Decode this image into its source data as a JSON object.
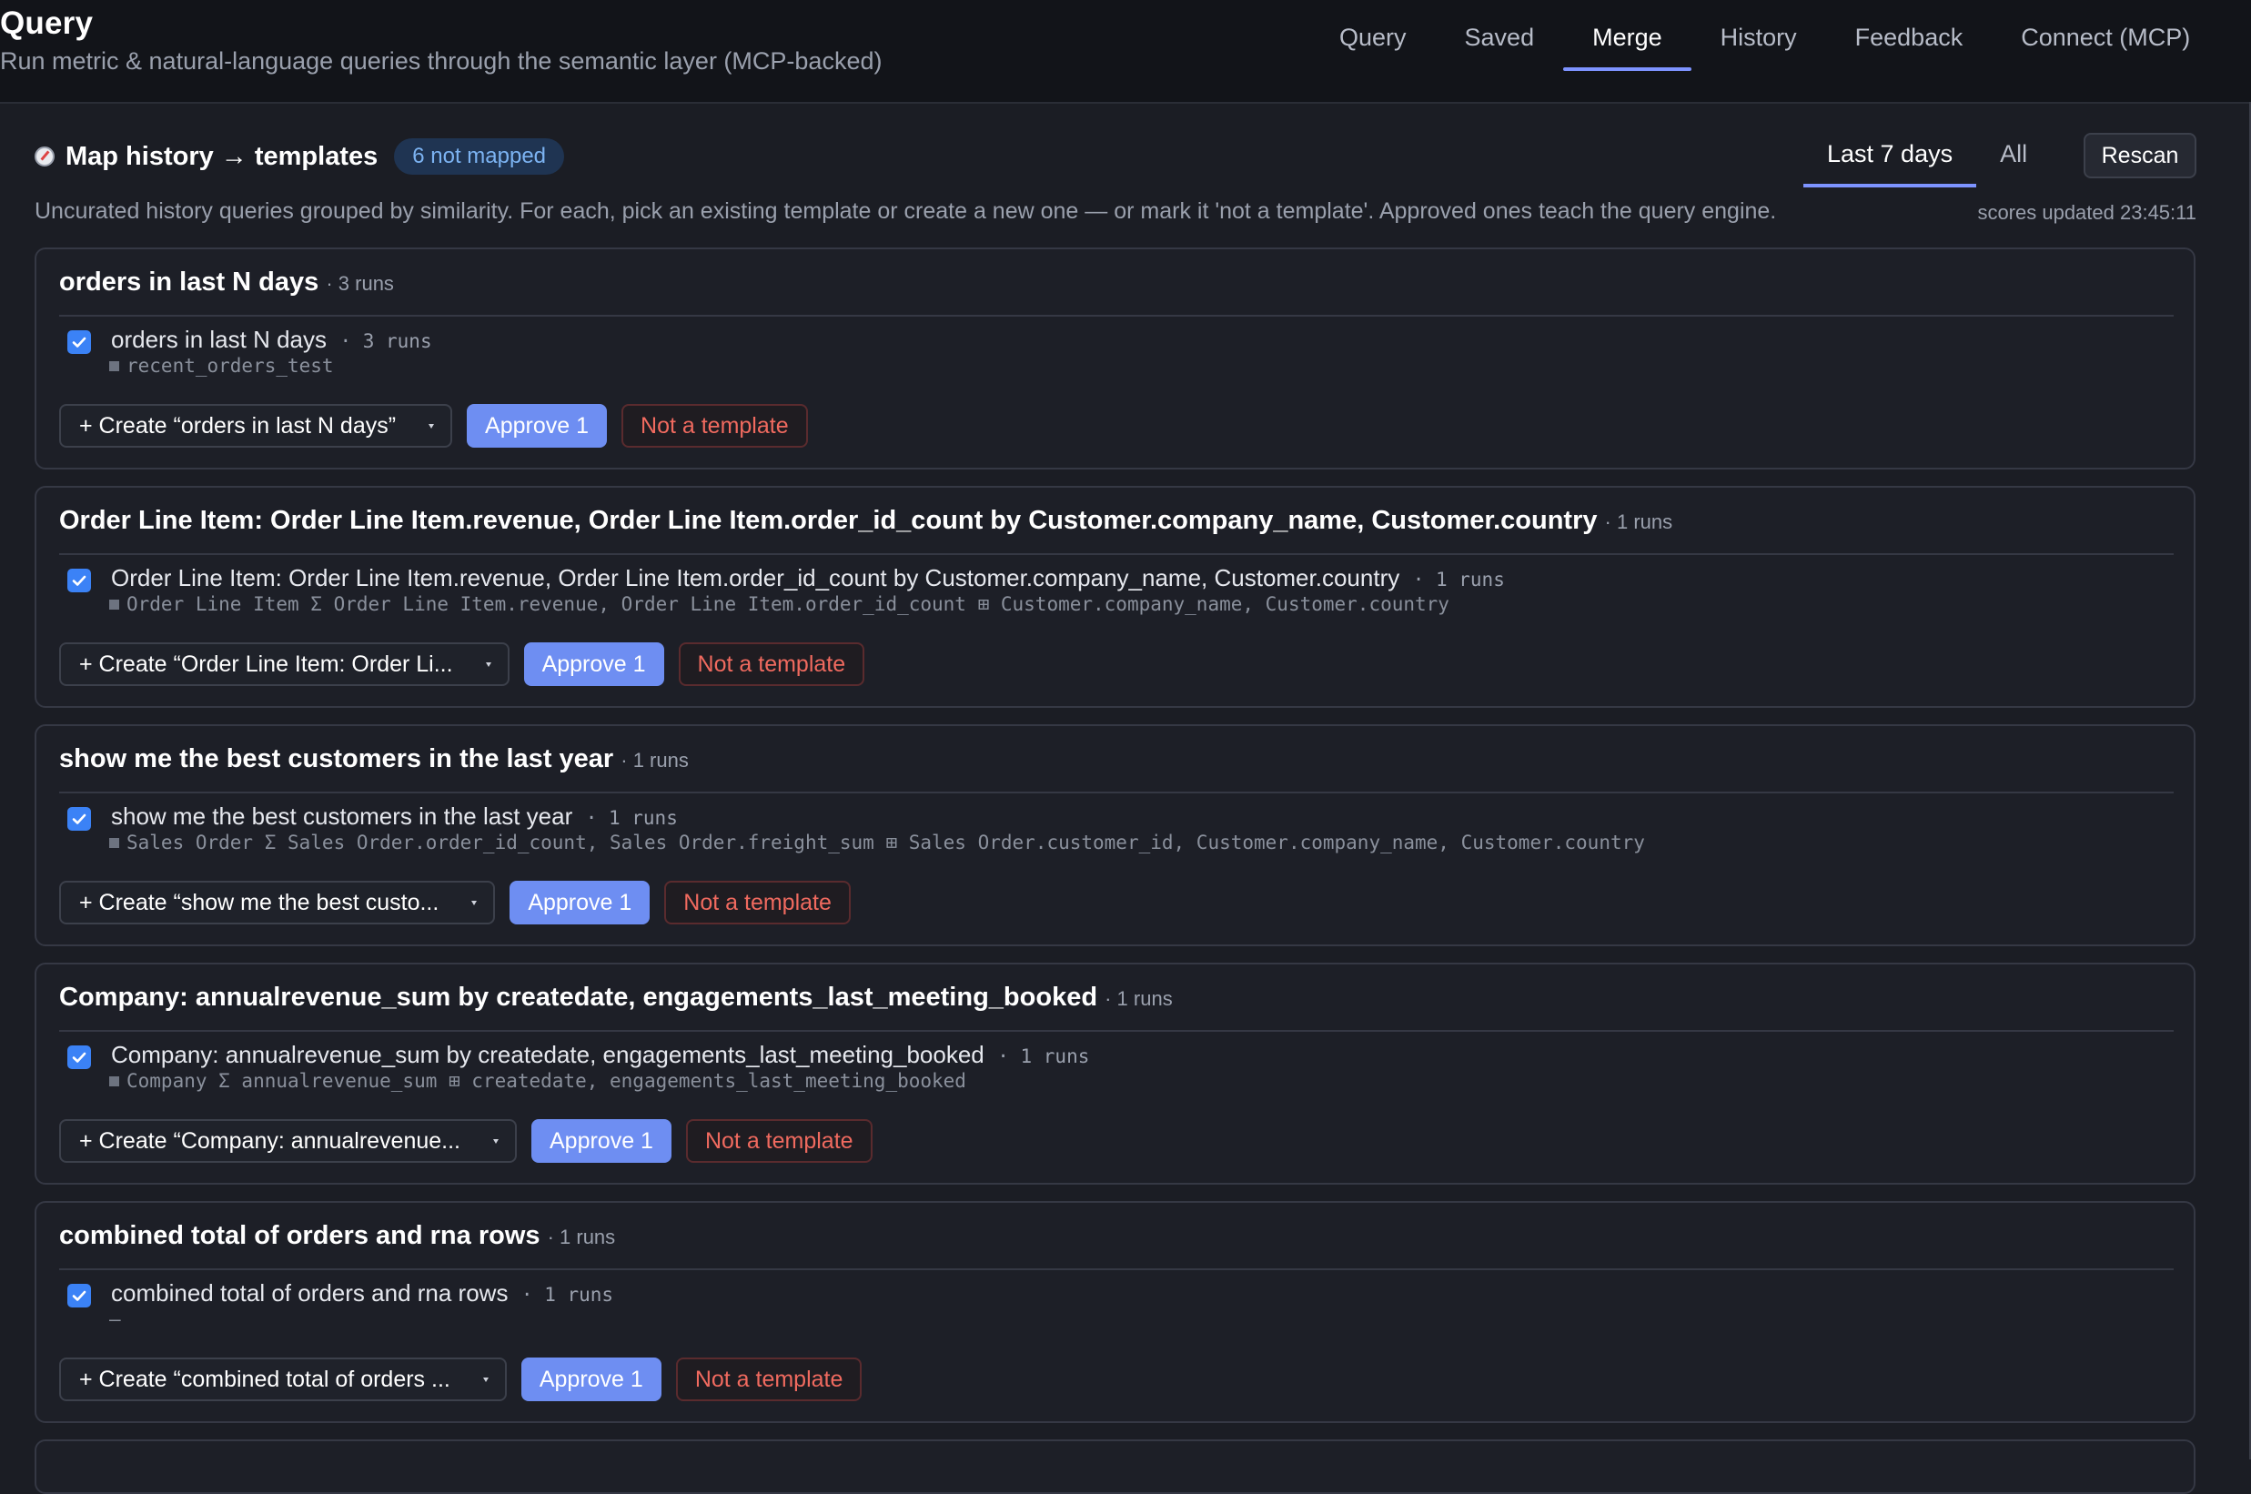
{
  "app": {
    "title": "Query",
    "subtitle": "Run metric & natural-language queries through the semantic layer (MCP-backed)"
  },
  "nav": {
    "tabs": [
      {
        "label": "Query",
        "active": false
      },
      {
        "label": "Saved",
        "active": false
      },
      {
        "label": "Merge",
        "active": true
      },
      {
        "label": "History",
        "active": false
      },
      {
        "label": "Feedback",
        "active": false
      },
      {
        "label": "Connect (MCP)",
        "active": false
      }
    ]
  },
  "section": {
    "icon": "compass-icon",
    "title": "Map history → templates",
    "not_mapped": "6 not mapped",
    "range_tabs": [
      {
        "label": "Last 7 days",
        "active": true
      },
      {
        "label": "All",
        "active": false
      }
    ],
    "rescan_label": "Rescan",
    "description": "Uncurated history queries grouped by similarity. For each, pick an existing template or create a new one — or mark it 'not a template'. Approved ones teach the query engine.",
    "scores_updated": "scores updated 23:45:11"
  },
  "colors": {
    "accent": "#7d93ff",
    "approve": "#6e8ef2",
    "reject_text": "#f06a5f",
    "checkbox": "#3b82f6"
  },
  "groups": [
    {
      "title": "orders in last N days",
      "runs": "· 3 runs",
      "item_text": "orders in last N days",
      "item_runs": "· 3 runs",
      "meta": "recent_orders_test",
      "meta_square": true,
      "create_label": "+ Create “orders in last N days”",
      "approve_label": "Approve 1",
      "reject_label": "Not a template"
    },
    {
      "title": "Order Line Item: Order Line Item.revenue, Order Line Item.order_id_count by Customer.company_name, Customer.country",
      "runs": "· 1 runs",
      "item_text": "Order Line Item: Order Line Item.revenue, Order Line Item.order_id_count by Customer.company_name, Customer.country",
      "item_runs": "· 1 runs",
      "meta": "Order Line Item  Σ Order Line Item.revenue, Order Line Item.order_id_count  ⊞ Customer.company_name, Customer.country",
      "meta_square": true,
      "create_label": "+ Create “Order Line Item: Order Li...",
      "approve_label": "Approve 1",
      "reject_label": "Not a template"
    },
    {
      "title": "show me the best customers in the last year",
      "runs": "· 1 runs",
      "item_text": "show me the best customers in the last year",
      "item_runs": "· 1 runs",
      "meta": "Sales Order  Σ Sales Order.order_id_count, Sales Order.freight_sum  ⊞ Sales Order.customer_id, Customer.company_name, Customer.country",
      "meta_square": true,
      "create_label": "+ Create “show me the best custo...",
      "approve_label": "Approve 1",
      "reject_label": "Not a template"
    },
    {
      "title": "Company: annualrevenue_sum by createdate, engagements_last_meeting_booked",
      "runs": "· 1 runs",
      "item_text": "Company: annualrevenue_sum by createdate, engagements_last_meeting_booked",
      "item_runs": "· 1 runs",
      "meta": "Company  Σ annualrevenue_sum  ⊞ createdate, engagements_last_meeting_booked",
      "meta_square": true,
      "create_label": "+ Create “Company: annualrevenue...",
      "approve_label": "Approve 1",
      "reject_label": "Not a template"
    },
    {
      "title": "combined total of orders and rna rows",
      "runs": "· 1 runs",
      "item_text": "combined total of orders and rna rows",
      "item_runs": "· 1 runs",
      "meta": "—",
      "meta_square": false,
      "create_label": "+ Create “combined total of orders ...",
      "approve_label": "Approve 1",
      "reject_label": "Not a template"
    }
  ]
}
